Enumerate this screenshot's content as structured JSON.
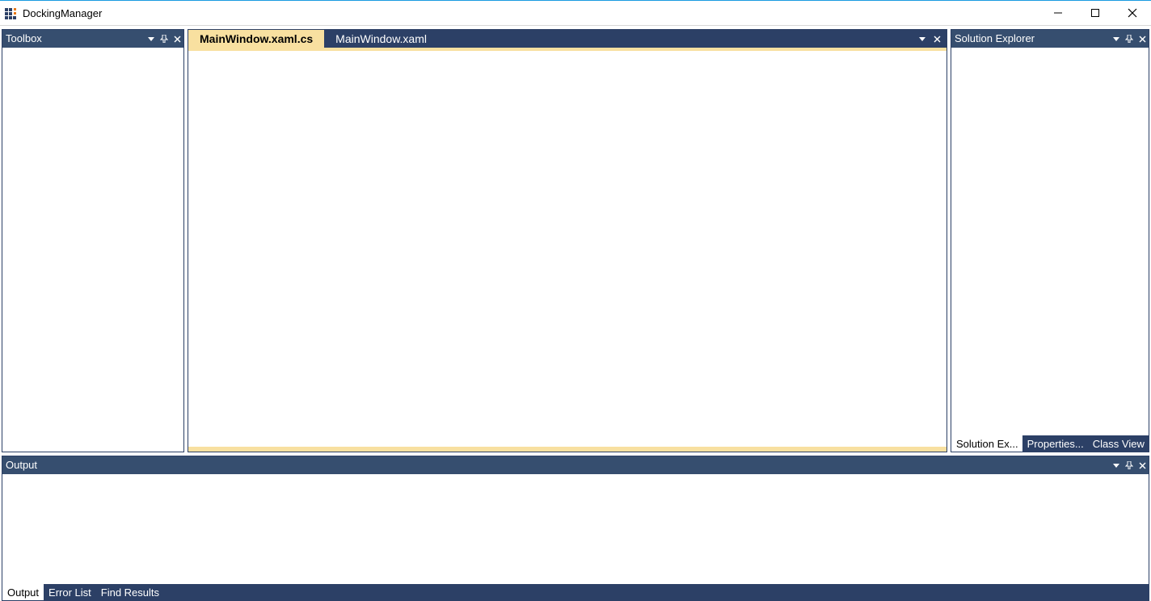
{
  "window": {
    "title": "DockingManager"
  },
  "panels": {
    "toolbox": {
      "title": "Toolbox"
    },
    "solutionExplorer": {
      "title": "Solution Explorer"
    },
    "output": {
      "title": "Output"
    }
  },
  "documents": {
    "tabs": [
      {
        "label": "MainWindow.xaml.cs",
        "active": true
      },
      {
        "label": "MainWindow.xaml",
        "active": false
      }
    ]
  },
  "rightTabs": [
    {
      "label": "Solution Ex...",
      "active": true
    },
    {
      "label": "Properties...",
      "active": false
    },
    {
      "label": "Class View",
      "active": false
    }
  ],
  "bottomTabs": [
    {
      "label": "Output",
      "active": true
    },
    {
      "label": "Error List",
      "active": false
    },
    {
      "label": "Find Results",
      "active": false
    }
  ],
  "colors": {
    "navy": "#2c4066",
    "navyLight": "#364e6f",
    "activeTab": "#f8e0a0",
    "accent": "#1a9be0"
  }
}
